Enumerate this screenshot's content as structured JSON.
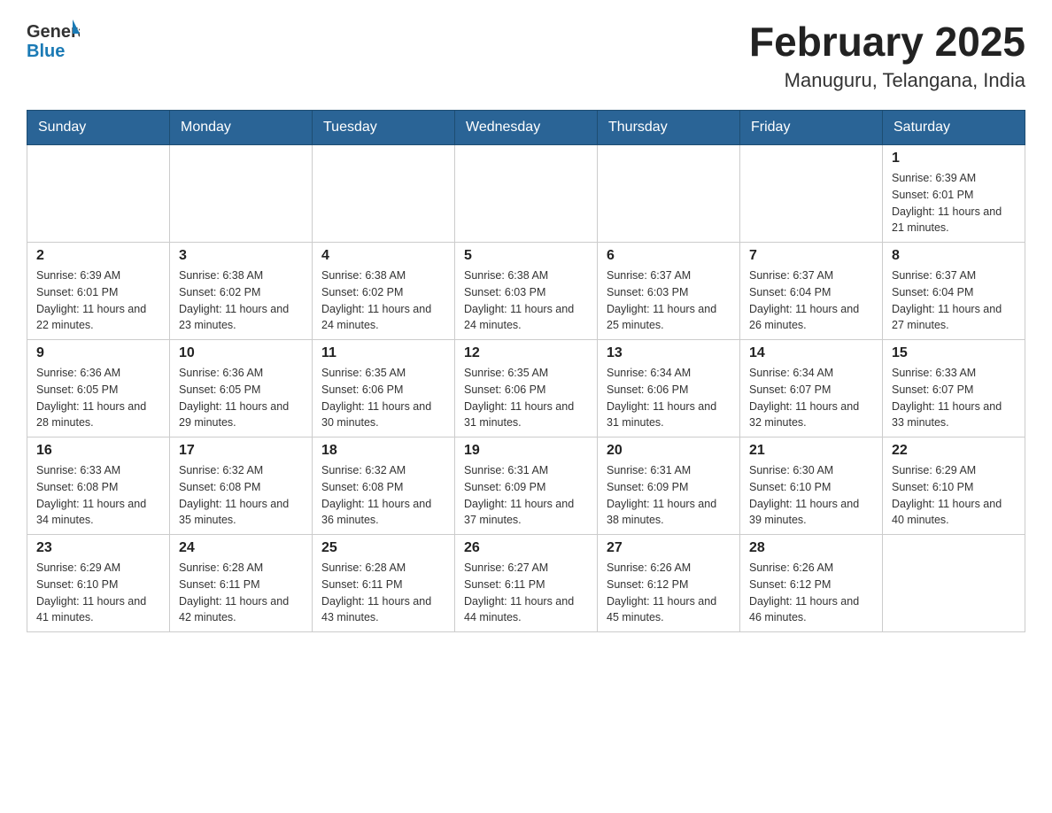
{
  "header": {
    "logo": {
      "text_general": "General",
      "text_blue": "Blue"
    },
    "month_title": "February 2025",
    "location": "Manuguru, Telangana, India"
  },
  "weekdays": [
    "Sunday",
    "Monday",
    "Tuesday",
    "Wednesday",
    "Thursday",
    "Friday",
    "Saturday"
  ],
  "weeks": [
    [
      {
        "day": "",
        "info": ""
      },
      {
        "day": "",
        "info": ""
      },
      {
        "day": "",
        "info": ""
      },
      {
        "day": "",
        "info": ""
      },
      {
        "day": "",
        "info": ""
      },
      {
        "day": "",
        "info": ""
      },
      {
        "day": "1",
        "info": "Sunrise: 6:39 AM\nSunset: 6:01 PM\nDaylight: 11 hours and 21 minutes."
      }
    ],
    [
      {
        "day": "2",
        "info": "Sunrise: 6:39 AM\nSunset: 6:01 PM\nDaylight: 11 hours and 22 minutes."
      },
      {
        "day": "3",
        "info": "Sunrise: 6:38 AM\nSunset: 6:02 PM\nDaylight: 11 hours and 23 minutes."
      },
      {
        "day": "4",
        "info": "Sunrise: 6:38 AM\nSunset: 6:02 PM\nDaylight: 11 hours and 24 minutes."
      },
      {
        "day": "5",
        "info": "Sunrise: 6:38 AM\nSunset: 6:03 PM\nDaylight: 11 hours and 24 minutes."
      },
      {
        "day": "6",
        "info": "Sunrise: 6:37 AM\nSunset: 6:03 PM\nDaylight: 11 hours and 25 minutes."
      },
      {
        "day": "7",
        "info": "Sunrise: 6:37 AM\nSunset: 6:04 PM\nDaylight: 11 hours and 26 minutes."
      },
      {
        "day": "8",
        "info": "Sunrise: 6:37 AM\nSunset: 6:04 PM\nDaylight: 11 hours and 27 minutes."
      }
    ],
    [
      {
        "day": "9",
        "info": "Sunrise: 6:36 AM\nSunset: 6:05 PM\nDaylight: 11 hours and 28 minutes."
      },
      {
        "day": "10",
        "info": "Sunrise: 6:36 AM\nSunset: 6:05 PM\nDaylight: 11 hours and 29 minutes."
      },
      {
        "day": "11",
        "info": "Sunrise: 6:35 AM\nSunset: 6:06 PM\nDaylight: 11 hours and 30 minutes."
      },
      {
        "day": "12",
        "info": "Sunrise: 6:35 AM\nSunset: 6:06 PM\nDaylight: 11 hours and 31 minutes."
      },
      {
        "day": "13",
        "info": "Sunrise: 6:34 AM\nSunset: 6:06 PM\nDaylight: 11 hours and 31 minutes."
      },
      {
        "day": "14",
        "info": "Sunrise: 6:34 AM\nSunset: 6:07 PM\nDaylight: 11 hours and 32 minutes."
      },
      {
        "day": "15",
        "info": "Sunrise: 6:33 AM\nSunset: 6:07 PM\nDaylight: 11 hours and 33 minutes."
      }
    ],
    [
      {
        "day": "16",
        "info": "Sunrise: 6:33 AM\nSunset: 6:08 PM\nDaylight: 11 hours and 34 minutes."
      },
      {
        "day": "17",
        "info": "Sunrise: 6:32 AM\nSunset: 6:08 PM\nDaylight: 11 hours and 35 minutes."
      },
      {
        "day": "18",
        "info": "Sunrise: 6:32 AM\nSunset: 6:08 PM\nDaylight: 11 hours and 36 minutes."
      },
      {
        "day": "19",
        "info": "Sunrise: 6:31 AM\nSunset: 6:09 PM\nDaylight: 11 hours and 37 minutes."
      },
      {
        "day": "20",
        "info": "Sunrise: 6:31 AM\nSunset: 6:09 PM\nDaylight: 11 hours and 38 minutes."
      },
      {
        "day": "21",
        "info": "Sunrise: 6:30 AM\nSunset: 6:10 PM\nDaylight: 11 hours and 39 minutes."
      },
      {
        "day": "22",
        "info": "Sunrise: 6:29 AM\nSunset: 6:10 PM\nDaylight: 11 hours and 40 minutes."
      }
    ],
    [
      {
        "day": "23",
        "info": "Sunrise: 6:29 AM\nSunset: 6:10 PM\nDaylight: 11 hours and 41 minutes."
      },
      {
        "day": "24",
        "info": "Sunrise: 6:28 AM\nSunset: 6:11 PM\nDaylight: 11 hours and 42 minutes."
      },
      {
        "day": "25",
        "info": "Sunrise: 6:28 AM\nSunset: 6:11 PM\nDaylight: 11 hours and 43 minutes."
      },
      {
        "day": "26",
        "info": "Sunrise: 6:27 AM\nSunset: 6:11 PM\nDaylight: 11 hours and 44 minutes."
      },
      {
        "day": "27",
        "info": "Sunrise: 6:26 AM\nSunset: 6:12 PM\nDaylight: 11 hours and 45 minutes."
      },
      {
        "day": "28",
        "info": "Sunrise: 6:26 AM\nSunset: 6:12 PM\nDaylight: 11 hours and 46 minutes."
      },
      {
        "day": "",
        "info": ""
      }
    ]
  ]
}
